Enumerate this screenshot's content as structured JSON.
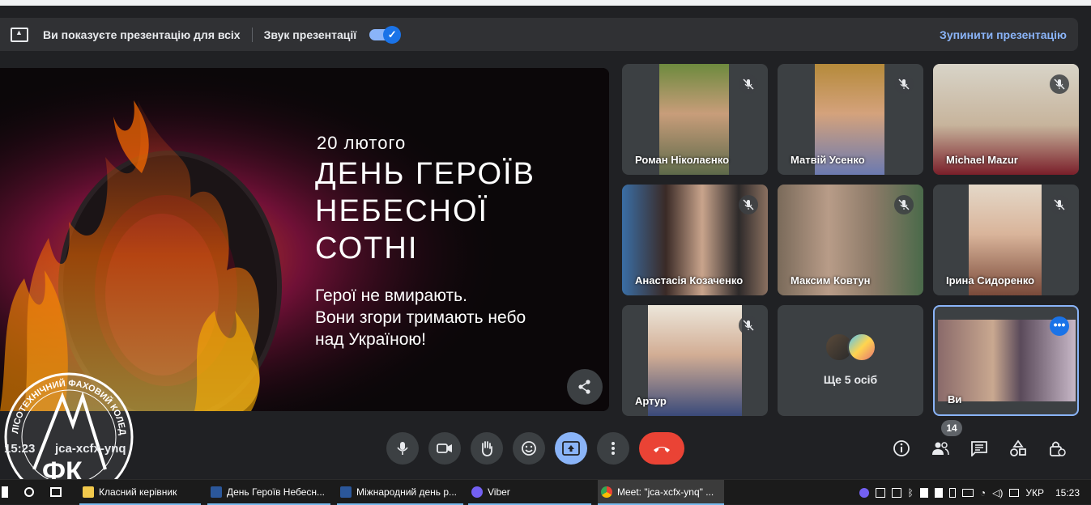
{
  "banner": {
    "presenting_text": "Ви показуєте презентацію для всіх",
    "sound_label": "Звук презентації",
    "sound_on": true,
    "stop_label": "Зупинити презентацію"
  },
  "slide": {
    "date": "20 лютого",
    "headline_1": "ДЕНЬ ГЕРОЇВ",
    "headline_2": "НЕБЕСНОЇ",
    "headline_3": "СОТНІ",
    "sub_1": "Герої не вмирають.",
    "sub_2": "Вони згори тримають небо",
    "sub_3": "над Україною!"
  },
  "participants": [
    {
      "name": "Роман Ніколаєнко",
      "muted": true
    },
    {
      "name": "Матвій Усенко",
      "muted": true
    },
    {
      "name": "Michael Mazur",
      "muted": true
    },
    {
      "name": "Анастасія Козаченко",
      "muted": true
    },
    {
      "name": "Максим Ковтун",
      "muted": true
    },
    {
      "name": "Ірина Сидоренко",
      "muted": true
    },
    {
      "name": "Артур",
      "muted": true
    },
    {
      "name": "Ви",
      "muted": false
    }
  ],
  "others_tile": {
    "label": "Ще 5 осіб"
  },
  "meeting": {
    "time": "15:23",
    "code": "jca-xcfx-ynq",
    "participant_count": "14"
  },
  "logo": {
    "text": "ЛИСИЧАНСЬКИЙ ЛІСОТЕХНІЧНИЙ ФАХОВИЙ КОЛЕДЖ",
    "initials": "ФК"
  },
  "taskbar": {
    "items": [
      {
        "label": "Класний керівник",
        "icon": "folder-icon"
      },
      {
        "label": "День Героїв Небесн...",
        "icon": "word-icon"
      },
      {
        "label": "Міжнародний день р...",
        "icon": "word-icon"
      },
      {
        "label": "Viber",
        "icon": "viber-icon"
      },
      {
        "label": "Meet: \"jca-xcfx-ynq\" ...",
        "icon": "chrome-icon"
      }
    ],
    "lang": "УКР",
    "clock": "15:23"
  },
  "colors": {
    "accent": "#8ab4f8",
    "hangup": "#ea4335",
    "background": "#202124",
    "tile": "#3c4043"
  }
}
